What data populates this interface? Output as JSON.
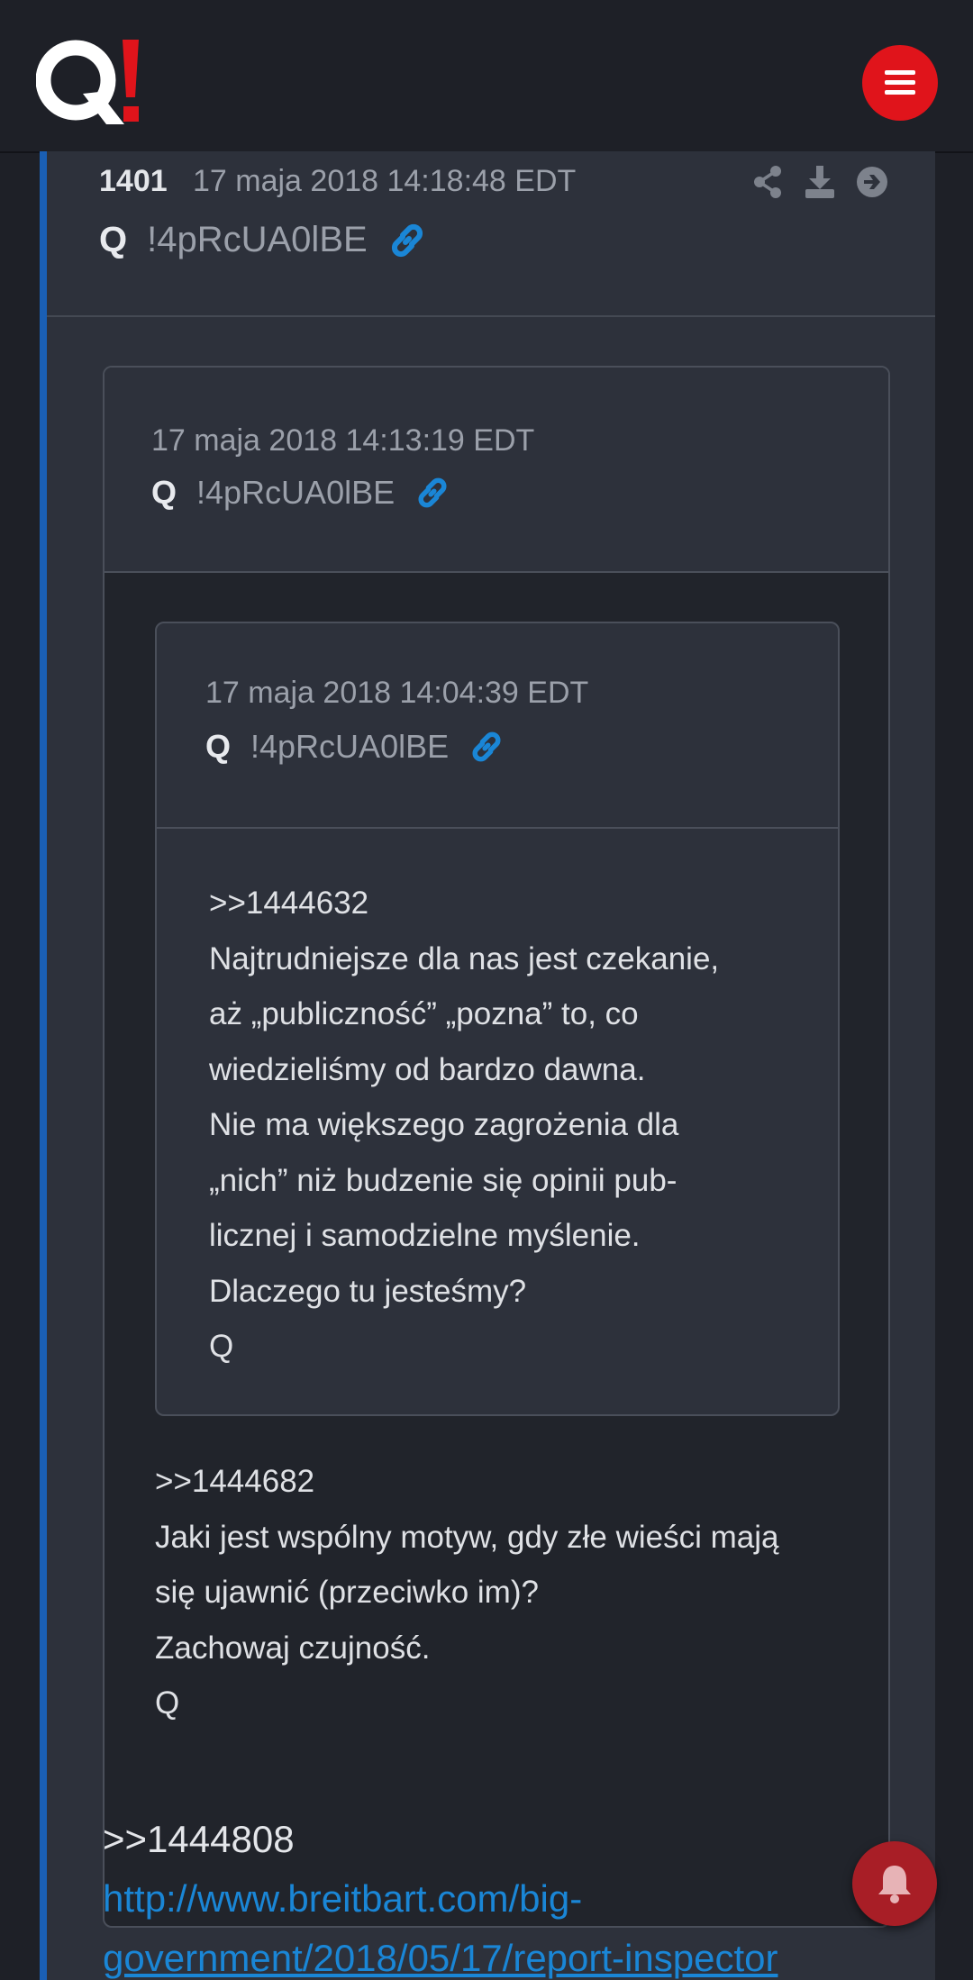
{
  "header": {
    "logo_text": "Q!",
    "menu_icon": "hamburger-menu-icon",
    "colors": {
      "brand_red": "#e0141b",
      "background": "#1e2027"
    }
  },
  "post": {
    "number": "1401",
    "timestamp": "17 maja 2018 14:18:48 EDT",
    "author": "Q",
    "tripcode": "!4pRcUA0lBE",
    "actions": [
      "share-icon",
      "download-icon",
      "arrow-right-icon"
    ],
    "accent_color": "#1a5fb4",
    "quote": {
      "timestamp": "17 maja 2018 14:13:19 EDT",
      "author": "Q",
      "tripcode": "!4pRcUA0lBE",
      "nested_quote": {
        "timestamp": "17 maja 2018 14:04:39 EDT",
        "author": "Q",
        "tripcode": "!4pRcUA0lBE",
        "lines": [
          ">>1444632",
          "Najtrudniejsze dla nas jest czekanie,",
          "aż „publiczność” „pozna” to, co",
          "wiedzieliśmy od bardzo dawna.",
          "Nie ma większego zagrożenia dla",
          "„nich” niż budzenie się opinii pub-",
          "licznej i samodzielne myślenie.",
          "Dlaczego tu jesteśmy?",
          "Q"
        ]
      },
      "lines": [
        ">>1444682",
        "Jaki jest wspólny motyw, gdy złe wieści mają",
        "się ujawnić (przeciwko im)?",
        "Zachowaj czujność.",
        "Q"
      ]
    },
    "reply_ref": ">>1444808",
    "link_line1": " http://www.breitbart.com/big-",
    "link_line2": "government/2018/05/17/report-inspector"
  },
  "notification": {
    "icon": "bell-icon"
  }
}
